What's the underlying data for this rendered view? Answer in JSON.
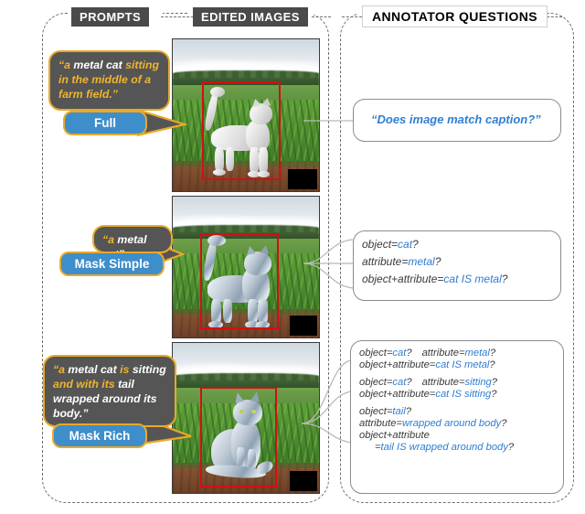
{
  "headers": {
    "prompts": "PROMPTS",
    "edited_images": "EDITED IMAGES",
    "annotator_questions": "ANNOTATOR QUESTIONS"
  },
  "rows": [
    {
      "id": "full",
      "button_label": "Full",
      "prompt": {
        "parts": [
          {
            "text": "“a ",
            "color": "yellow"
          },
          {
            "text": "metal cat ",
            "color": "white"
          },
          {
            "text": "sitting in the middle of a farm field.”",
            "color": "yellow"
          }
        ],
        "plain": "“a metal cat sitting in the middle of a farm field.”"
      },
      "image": {
        "alt": "white cat statue standing in a cornfield",
        "bbox_label": "red bounding box around cat"
      },
      "questions": [
        {
          "line": "“Does image match caption?”",
          "style": "headline"
        }
      ]
    },
    {
      "id": "mask-simple",
      "button_label": "Mask Simple",
      "prompt": {
        "parts": [
          {
            "text": "“a ",
            "color": "yellow"
          },
          {
            "text": "metal cat”",
            "color": "white"
          }
        ],
        "plain": "“a metal cat”"
      },
      "image": {
        "alt": "silver metallic cat statue standing in a cornfield",
        "bbox_label": "red bounding box around cat"
      },
      "questions": [
        {
          "label": "object=",
          "value": "cat",
          "suffix": "?"
        },
        {
          "label": "attribute=",
          "value": "metal",
          "suffix": "?"
        },
        {
          "label": "object+attribute=",
          "value": "cat IS metal",
          "suffix": "?"
        }
      ]
    },
    {
      "id": "mask-rich",
      "button_label": "Mask Rich",
      "prompt": {
        "parts": [
          {
            "text": "“a ",
            "color": "yellow"
          },
          {
            "text": "metal cat ",
            "color": "white"
          },
          {
            "text": "is ",
            "color": "yellow"
          },
          {
            "text": "sitting ",
            "color": "white"
          },
          {
            "text": "and with its ",
            "color": "yellow"
          },
          {
            "text": "tail wrapped around its body.”",
            "color": "white"
          }
        ],
        "plain": "“a metal cat is sitting and with its tail wrapped around its body.”"
      },
      "image": {
        "alt": "silver metallic cat statue sitting with tail wrapped around body",
        "bbox_label": "red bounding box around cat"
      },
      "question_groups": [
        {
          "lines": [
            {
              "pair": [
                {
                  "label": "object=",
                  "value": "cat",
                  "suffix": "?"
                },
                {
                  "label": "attribute=",
                  "value": "metal",
                  "suffix": "?"
                }
              ]
            },
            {
              "label": "object+attribute=",
              "value": "cat IS metal",
              "suffix": "?"
            }
          ]
        },
        {
          "lines": [
            {
              "pair": [
                {
                  "label": "object=",
                  "value": "cat",
                  "suffix": "?"
                },
                {
                  "label": "attribute=",
                  "value": "sitting",
                  "suffix": "?"
                }
              ]
            },
            {
              "label": "object+attribute=",
              "value": "cat IS sitting",
              "suffix": "?"
            }
          ]
        },
        {
          "lines": [
            {
              "label": "object=",
              "value": "tail",
              "suffix": "?"
            },
            {
              "label": "attribute=",
              "value": "wrapped around body",
              "suffix": "?"
            },
            {
              "label": "object+attribute",
              "value": "",
              "suffix": ""
            },
            {
              "label": "=",
              "value": "tail IS wrapped around body",
              "suffix": "?",
              "indent": true
            }
          ]
        }
      ]
    }
  ],
  "colors": {
    "bubble_background": "#555555",
    "bubble_border": "#e8a929",
    "highlight_text": "#f0b52b",
    "button_blue": "#3d8ecb",
    "question_blue": "#2e7dd1",
    "bbox_red": "#cf1111",
    "panel_dash": "#6f6f6f",
    "chip_dark": "#4a4a4a"
  }
}
